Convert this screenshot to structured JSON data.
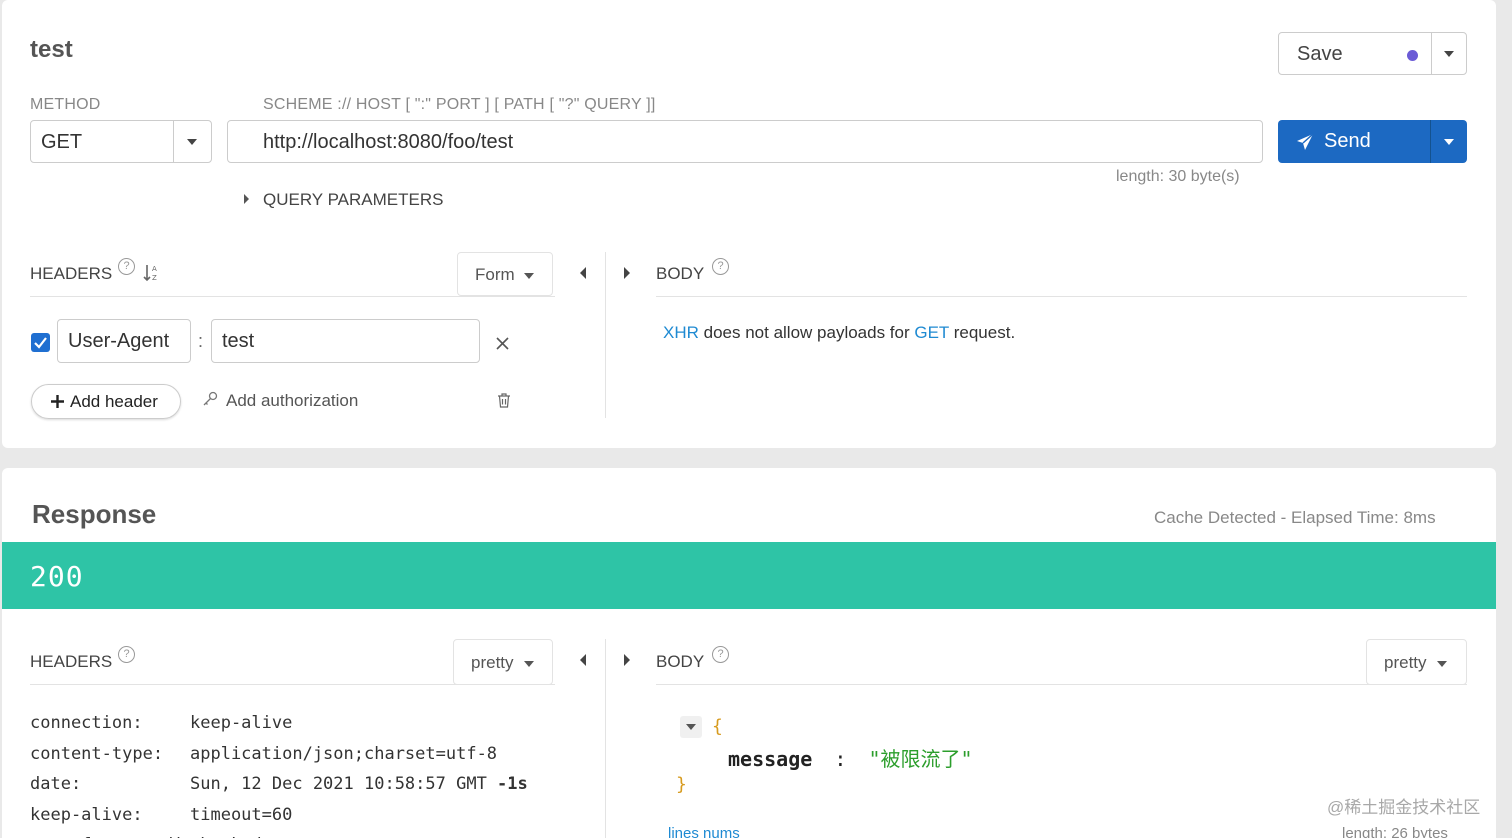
{
  "request": {
    "title": "test",
    "save_label": "Save",
    "method_label": "METHOD",
    "method_value": "GET",
    "url_label": "SCHEME :// HOST [ \":\" PORT ] [ PATH [ \"?\" QUERY ]]",
    "url_value": "http://localhost:8080/foo/test",
    "url_length": "length: 30 byte(s)",
    "send_label": "Send",
    "query_params_label": "QUERY PARAMETERS",
    "headers_label": "HEADERS",
    "headers_mode": "Form",
    "body_label": "BODY",
    "header_row": {
      "checked": true,
      "key": "User-Agent",
      "separator": ":",
      "value": "test"
    },
    "add_header_label": "Add header",
    "add_auth_label": "Add authorization",
    "body_message": {
      "part1": "XHR",
      "part2": " does not allow payloads for ",
      "part3": "GET",
      "part4": " request."
    }
  },
  "response": {
    "title": "Response",
    "cache_info": "Cache Detected - Elapsed Time: 8ms",
    "status_code": "200",
    "headers_label": "HEADERS",
    "headers_mode": "pretty",
    "body_label": "BODY",
    "body_mode": "pretty",
    "headers": [
      {
        "name": "connection:",
        "value": "keep-alive"
      },
      {
        "name": "content-type:",
        "value": "application/json;charset=utf-8"
      },
      {
        "name": "date:",
        "value": "Sun, 12 Dec 2021 10:58:57 GMT ",
        "extra": "-1s"
      },
      {
        "name": "keep-alive:",
        "value": "timeout=60"
      },
      {
        "name": "transfer-encoding:",
        "value": "chunked"
      }
    ],
    "json": {
      "open": "{",
      "key": "message",
      "colon": ":",
      "value": "\"被限流了\"",
      "close": "}"
    },
    "lines_nums_label": "lines nums",
    "body_length": "length: 26 bytes"
  },
  "watermark": "@稀土掘金技术社区",
  "colors": {
    "accent": "#1c69c2",
    "status_ok": "#2ec4a6",
    "link": "#1f8ad2",
    "json_string": "#2c9e2c",
    "json_brace": "#d79b1f",
    "save_dot": "#6b5bd6"
  }
}
